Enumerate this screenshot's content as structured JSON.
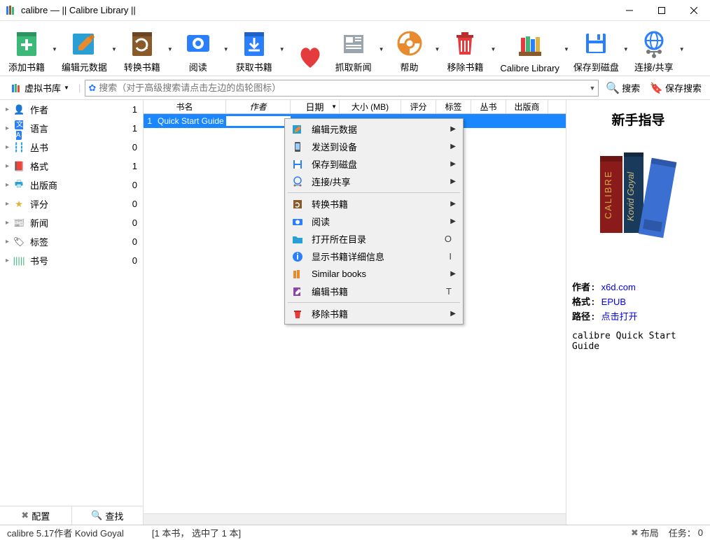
{
  "title": "calibre — || Calibre Library ||",
  "toolbar": [
    {
      "id": "add",
      "label": "添加书籍",
      "arrow": true
    },
    {
      "id": "editmeta",
      "label": "编辑元数据",
      "arrow": true
    },
    {
      "id": "convert",
      "label": "转换书籍",
      "arrow": true
    },
    {
      "id": "view",
      "label": "阅读",
      "arrow": true
    },
    {
      "id": "fetch",
      "label": "获取书籍",
      "arrow": true
    },
    {
      "id": "heart",
      "label": "",
      "arrow": false
    },
    {
      "id": "news",
      "label": "抓取新闻",
      "arrow": true
    },
    {
      "id": "help",
      "label": "帮助",
      "arrow": true
    },
    {
      "id": "remove",
      "label": "移除书籍",
      "arrow": true
    },
    {
      "id": "library",
      "label": "Calibre Library",
      "arrow": true
    },
    {
      "id": "save",
      "label": "保存到磁盘",
      "arrow": true
    },
    {
      "id": "connect",
      "label": "连接/共享",
      "arrow": true
    }
  ],
  "search": {
    "virtual_library": "虚拟书库",
    "placeholder": "搜索（对于高级搜索请点击左边的齿轮图标）",
    "search_btn": "搜索",
    "save_search": "保存搜索"
  },
  "sidebar": {
    "items": [
      {
        "icon": "author",
        "label": "作者",
        "count": 1,
        "color": "#2a7fff"
      },
      {
        "icon": "lang",
        "label": "语言",
        "count": 1,
        "color": "#2a7fff"
      },
      {
        "icon": "series",
        "label": "丛书",
        "count": 0,
        "color": "#2a9fd6"
      },
      {
        "icon": "format",
        "label": "格式",
        "count": 1,
        "color": "#8b5a2b"
      },
      {
        "icon": "publisher",
        "label": "出版商",
        "count": 0,
        "color": "#2aa0d0"
      },
      {
        "icon": "rating",
        "label": "评分",
        "count": 0,
        "color": "#e2b23e"
      },
      {
        "icon": "newsfeed",
        "label": "新闻",
        "count": 0,
        "color": "#2aa0d0"
      },
      {
        "icon": "tag",
        "label": "标签",
        "count": 0,
        "color": "#333"
      },
      {
        "icon": "id",
        "label": "书号",
        "count": 0,
        "color": "#3cb878"
      }
    ],
    "config": "配置",
    "find": "查找"
  },
  "columns": {
    "title": "书名",
    "author": "作者",
    "date": "日期",
    "size": "大小 (MB)",
    "rating": "评分",
    "tags": "标签",
    "series": "丛书",
    "publisher": "出版商"
  },
  "rows": [
    {
      "num": "1",
      "title": "Quick Start Guide",
      "author": "x6d.com"
    }
  ],
  "context_menu": [
    {
      "type": "item",
      "icon": "editmeta",
      "label": "编辑元数据",
      "sub": true
    },
    {
      "type": "item",
      "icon": "send",
      "label": "发送到设备",
      "sub": true
    },
    {
      "type": "item",
      "icon": "savedisk",
      "label": "保存到磁盘",
      "sub": true
    },
    {
      "type": "item",
      "icon": "share",
      "label": "连接/共享",
      "sub": true
    },
    {
      "type": "sep"
    },
    {
      "type": "item",
      "icon": "convert",
      "label": "转换书籍",
      "sub": true
    },
    {
      "type": "item",
      "icon": "view",
      "label": "阅读",
      "sub": true
    },
    {
      "type": "item",
      "icon": "folder",
      "label": "打开所在目录",
      "key": "O"
    },
    {
      "type": "item",
      "icon": "info",
      "label": "显示书籍详细信息",
      "key": "I"
    },
    {
      "type": "item",
      "icon": "similar",
      "label": "Similar books",
      "sub": true
    },
    {
      "type": "item",
      "icon": "editbook",
      "label": "编辑书籍",
      "key": "T"
    },
    {
      "type": "sep"
    },
    {
      "type": "item",
      "icon": "trash",
      "label": "移除书籍",
      "sub": true
    }
  ],
  "details": {
    "title": "新手指导",
    "meta": [
      {
        "k": "作者",
        "v": "x6d.com"
      },
      {
        "k": "格式",
        "v": "EPUB"
      },
      {
        "k": "路径",
        "v": "点击打开"
      }
    ],
    "desc": "calibre Quick Start Guide"
  },
  "status": {
    "version": "calibre 5.17作者 Kovid Goyal",
    "count": "[1 本书， 选中了 1 本]",
    "layout": "布局",
    "jobs_label": "任务：",
    "jobs": "0"
  }
}
